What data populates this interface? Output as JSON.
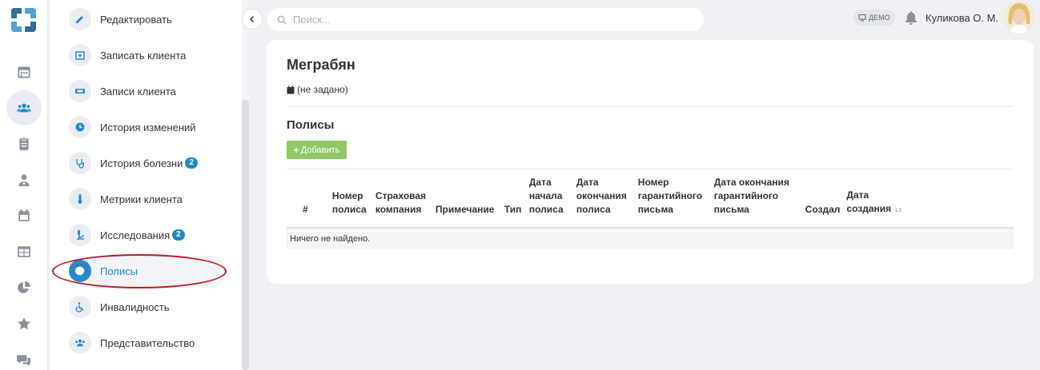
{
  "rail": {
    "items": [
      {
        "icon": "calendar-icon"
      },
      {
        "icon": "users-icon",
        "active": true
      },
      {
        "icon": "clipboard-icon"
      },
      {
        "icon": "doctor-icon"
      },
      {
        "icon": "schedule-icon"
      },
      {
        "icon": "table-icon"
      },
      {
        "icon": "pie-chart-icon"
      },
      {
        "icon": "star-icon"
      },
      {
        "icon": "chat-icon"
      }
    ]
  },
  "submenu": {
    "items": [
      {
        "label": "Редактировать",
        "icon": "pencil-icon"
      },
      {
        "label": "Записать клиента",
        "icon": "calendar-plus-icon"
      },
      {
        "label": "Записи клиента",
        "icon": "ticket-icon"
      },
      {
        "label": "История изменений",
        "icon": "clock-icon"
      },
      {
        "label": "История болезни",
        "icon": "stethoscope-icon",
        "badge": "2"
      },
      {
        "label": "Метрики клиента",
        "icon": "thermometer-icon"
      },
      {
        "label": "Исследования",
        "icon": "microscope-icon",
        "badge": "2"
      },
      {
        "label": "Полисы",
        "icon": "certificate-icon",
        "active": true
      },
      {
        "label": "Инвалидность",
        "icon": "wheelchair-icon"
      },
      {
        "label": "Представительство",
        "icon": "users-icon"
      }
    ]
  },
  "search": {
    "placeholder": "Поиск..."
  },
  "header": {
    "demo_label": "ДЕМО",
    "user_name": "Куликова О. М."
  },
  "client": {
    "name": "Меграбян",
    "birth_date": "(не задано)"
  },
  "policies": {
    "title": "Полисы",
    "add_label": "Добавить",
    "columns": [
      "#",
      "Номер полиса",
      "Страховая компания",
      "Примечание",
      "Тип",
      "Дата начала полиса",
      "Дата окончания полиса",
      "Номер гарантийного письма",
      "Дата окончания гарантийного письма",
      "Создал",
      "Дата создания"
    ],
    "empty_text": "Ничего не найдено."
  },
  "colors": {
    "accent": "#2a89c5",
    "add_button": "#8fc967",
    "highlight_oval": "#b31f24"
  }
}
